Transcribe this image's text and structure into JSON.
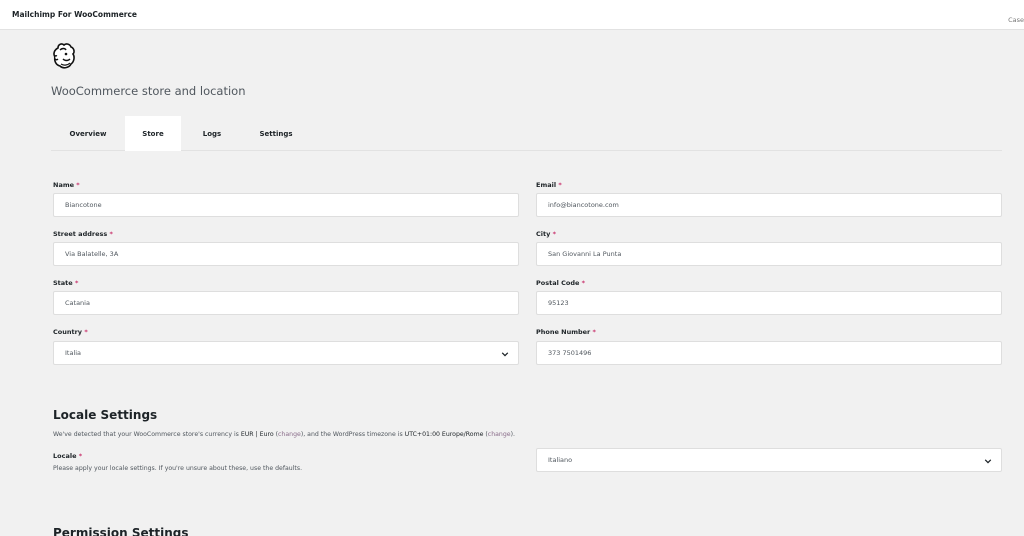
{
  "topbar": {
    "title": "Mailchimp For WooCommerce",
    "right_text": "Case"
  },
  "header": {
    "logo_icon": "mailchimp-freddie-icon",
    "page_title": "WooCommerce store and location"
  },
  "tabs": [
    {
      "label": "Overview",
      "active": false
    },
    {
      "label": "Store",
      "active": true
    },
    {
      "label": "Logs",
      "active": false
    },
    {
      "label": "Settings",
      "active": false
    }
  ],
  "form": {
    "required_mark": "*",
    "name": {
      "label": "Name",
      "value": "Biancotone"
    },
    "email": {
      "label": "Email",
      "value": "info@biancotone.com"
    },
    "street": {
      "label": "Street address",
      "value": "Via Balatelle, 3A"
    },
    "city": {
      "label": "City",
      "value": "San Giovanni La Punta"
    },
    "state": {
      "label": "State",
      "value": "Catania"
    },
    "postal": {
      "label": "Postal Code",
      "value": "95123"
    },
    "country": {
      "label": "Country",
      "value": "Italia"
    },
    "phone": {
      "label": "Phone Number",
      "value": "373 7501496"
    }
  },
  "locale": {
    "heading": "Locale Settings",
    "desc_prefix": "We've detected that your WooCommerce store's currency is ",
    "currency": "EUR | Euro",
    "change_link": "change",
    "desc_middle": "), and the WordPress timezone is ",
    "timezone": "UTC+01:00 Europe/Rome",
    "desc_suffix": ").",
    "locale_label": "Locale",
    "locale_help": "Please apply your locale settings. If you're unsure about these, use the defaults.",
    "locale_value": "Italiano"
  },
  "permission": {
    "heading": "Permission Settings"
  },
  "colors": {
    "accent": "#c9356e",
    "link": "#8a6d8a"
  }
}
